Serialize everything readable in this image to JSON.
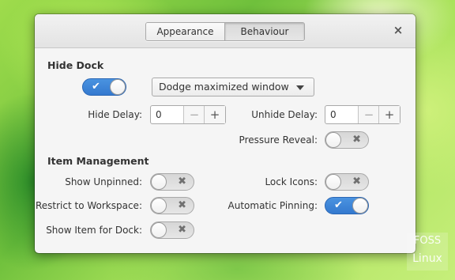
{
  "window": {
    "tabs": [
      {
        "label": "Appearance",
        "selected": false
      },
      {
        "label": "Behaviour",
        "selected": true
      }
    ],
    "close_glyph": "×"
  },
  "hide_dock": {
    "title": "Hide Dock",
    "enabled": true,
    "mode_value": "Dodge maximized window",
    "hide_delay_label": "Hide Delay:",
    "hide_delay_value": "0",
    "unhide_delay_label": "Unhide Delay:",
    "unhide_delay_value": "0",
    "pressure_reveal_label": "Pressure Reveal:",
    "pressure_reveal": false
  },
  "item_management": {
    "title": "Item Management",
    "show_unpinned_label": "Show Unpinned:",
    "show_unpinned": false,
    "lock_icons_label": "Lock Icons:",
    "lock_icons": false,
    "restrict_label": "Restrict to Workspace:",
    "restrict": false,
    "auto_pin_label": "Automatic Pinning:",
    "auto_pin": true,
    "show_item_label": "Show Item for Dock:",
    "show_item": false
  },
  "glyphs": {
    "check": "✔",
    "cross": "✖",
    "minus": "−",
    "plus": "+"
  },
  "watermark": {
    "line1": "FOSS",
    "line2": "Linux"
  },
  "colors": {
    "accent": "#3a84d8",
    "window_bg": "#f5f5f5"
  }
}
